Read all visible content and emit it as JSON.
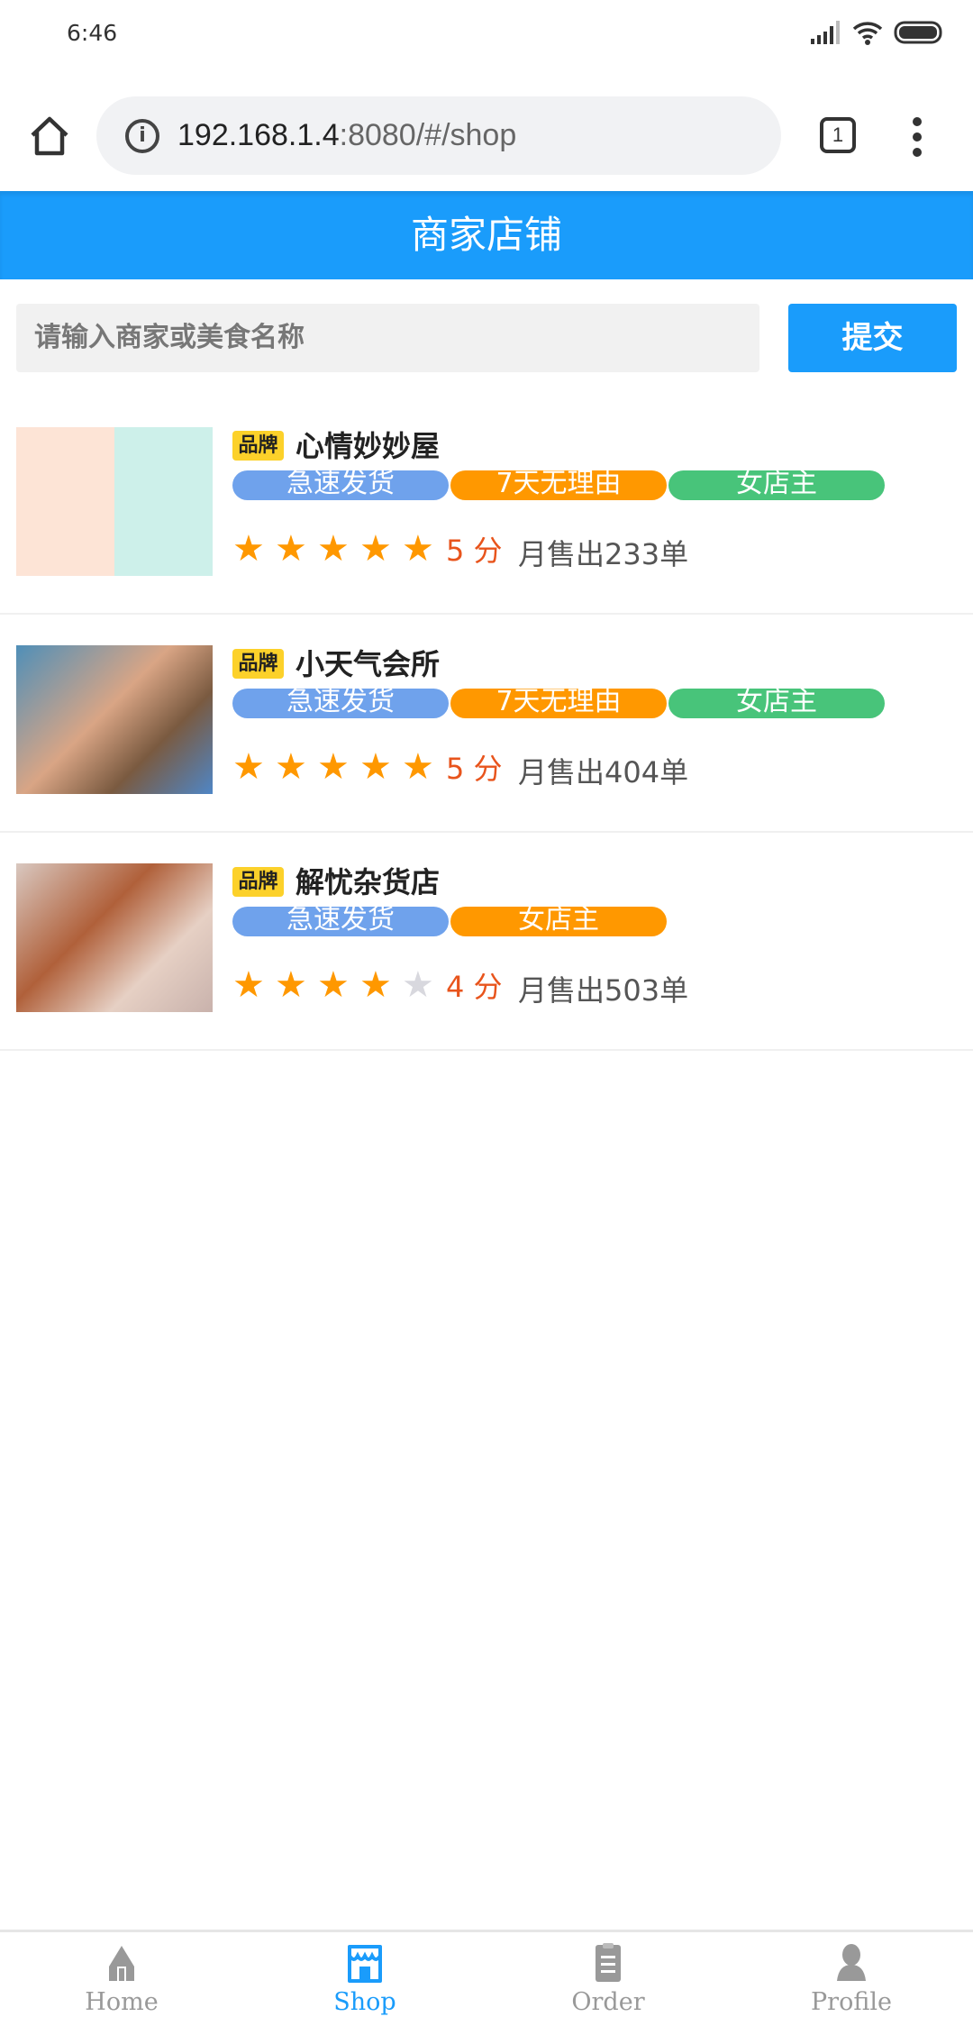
{
  "status_bar": {
    "time": "6:46"
  },
  "browser": {
    "url_host": "192.168.1.4",
    "url_rest": ":8080/#/shop",
    "tab_count": "1"
  },
  "header": {
    "title": "商家店铺"
  },
  "search": {
    "placeholder": "请输入商家或美食名称",
    "submit_label": "提交"
  },
  "shops": [
    {
      "brand": "品牌",
      "name": "心情妙妙屋",
      "tags": [
        {
          "label": "急速发货",
          "color": "#6fa2ec"
        },
        {
          "label": "7天无理由",
          "color": "#ff9800"
        },
        {
          "label": "女店主",
          "color": "#48c47a"
        }
      ],
      "rating": 5,
      "score_text": "5 分",
      "sold": "月售出233单"
    },
    {
      "brand": "品牌",
      "name": "小天气会所",
      "tags": [
        {
          "label": "急速发货",
          "color": "#6fa2ec"
        },
        {
          "label": "7天无理由",
          "color": "#ff9800"
        },
        {
          "label": "女店主",
          "color": "#48c47a"
        }
      ],
      "rating": 5,
      "score_text": "5 分",
      "sold": "月售出404单"
    },
    {
      "brand": "品牌",
      "name": "解忧杂货店",
      "tags": [
        {
          "label": "急速发货",
          "color": "#6fa2ec"
        },
        {
          "label": "女店主",
          "color": "#ff9800"
        }
      ],
      "rating": 4,
      "score_text": "4 分",
      "sold": "月售出503单"
    }
  ],
  "nav": {
    "items": [
      {
        "label": "Home"
      },
      {
        "label": "Shop"
      },
      {
        "label": "Order"
      },
      {
        "label": "Profile"
      }
    ],
    "active": "Shop",
    "accent": "#1a9cfb"
  }
}
